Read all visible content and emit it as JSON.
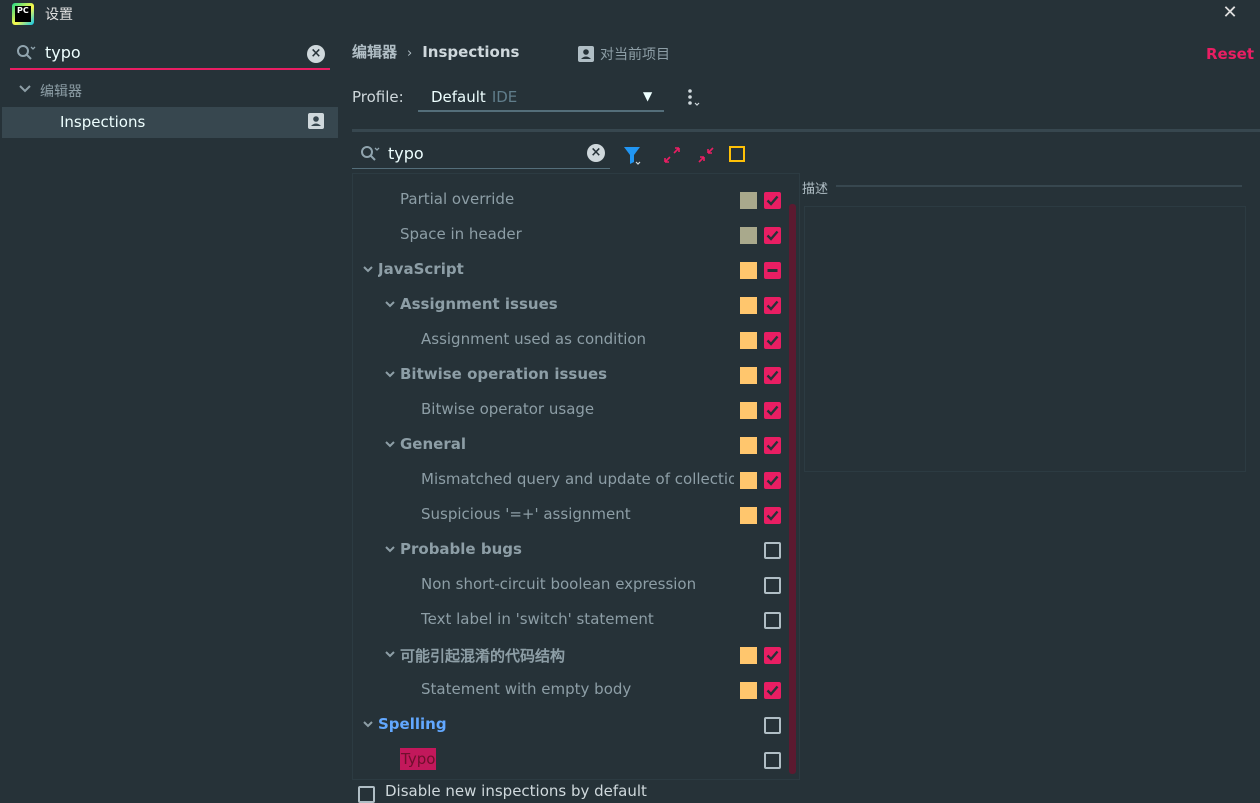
{
  "window": {
    "title": "设置",
    "app_icon_text": "PC"
  },
  "sidebar": {
    "search": {
      "value": "typo"
    },
    "group_label": "编辑器",
    "selected_item": "Inspections"
  },
  "header": {
    "breadcrumb": [
      "编辑器",
      "Inspections"
    ],
    "scope_label": "对当前项目",
    "reset_label": "Reset"
  },
  "profile": {
    "label": "Profile:",
    "value": "Default",
    "hint": "IDE"
  },
  "filter": {
    "value": "typo"
  },
  "tree_rows": [
    {
      "label": "Partial override",
      "sev": "#a9a98c",
      "check": "on"
    },
    {
      "label": "Space in header",
      "sev": "#a9a98c",
      "check": "on"
    },
    {
      "label": "JavaScript",
      "sev": "#ffc66d",
      "check": "partial"
    },
    {
      "label": "Assignment issues",
      "sev": "#ffc66d",
      "check": "on"
    },
    {
      "label": "Assignment used as condition",
      "sev": "#ffc66d",
      "check": "on"
    },
    {
      "label": "Bitwise operation issues",
      "sev": "#ffc66d",
      "check": "on"
    },
    {
      "label": "Bitwise operator usage",
      "sev": "#ffc66d",
      "check": "on"
    },
    {
      "label": "General",
      "sev": "#ffc66d",
      "check": "on"
    },
    {
      "label": "Mismatched query and update of collection",
      "sev": "#ffc66d",
      "check": "on"
    },
    {
      "label": "Suspicious '=+' assignment",
      "sev": "#ffc66d",
      "check": "on"
    },
    {
      "label": "Probable bugs",
      "sev": "",
      "check": "off"
    },
    {
      "label": "Non short-circuit boolean expression",
      "sev": "",
      "check": "off"
    },
    {
      "label": "Text label in 'switch' statement",
      "sev": "",
      "check": "off"
    },
    {
      "label": "可能引起混淆的代码结构",
      "sev": "#ffc66d",
      "check": "on"
    },
    {
      "label": "Statement with empty body",
      "sev": "#ffc66d",
      "check": "on"
    },
    {
      "label": "Spelling",
      "sev": "",
      "check": "off"
    },
    {
      "label": "Typo",
      "sev": "",
      "check": "off"
    }
  ],
  "description": {
    "label": "描述"
  },
  "footer": {
    "checkbox_label": "Disable new inspections by default"
  },
  "colors": {
    "accent": "#e91e63",
    "background": "#263238",
    "selection": "#37474f",
    "link_blue": "#62a8ff"
  }
}
